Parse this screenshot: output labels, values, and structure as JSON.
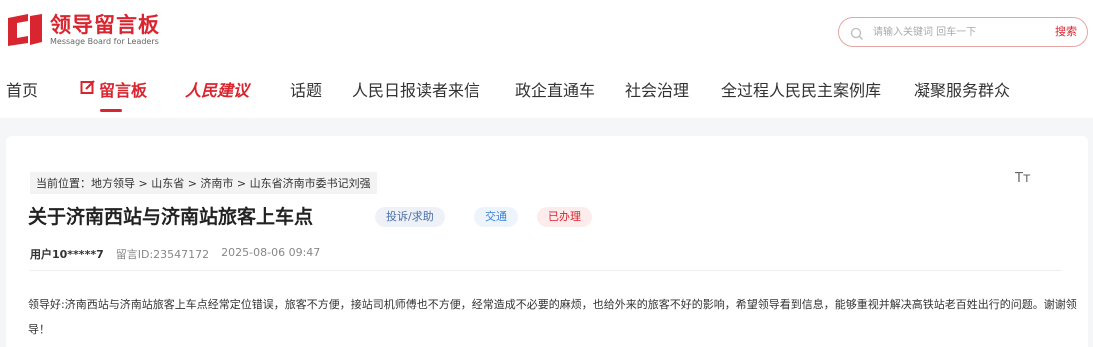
{
  "header": {
    "logo_title": "领导留言板",
    "logo_subtitle": "Message Board for Leaders",
    "brand_color": "#d9252f"
  },
  "search": {
    "placeholder": "请输入关键词 回车一下",
    "button_label": "搜索"
  },
  "nav": {
    "items": [
      {
        "label": "首页"
      },
      {
        "label": "留言板",
        "active": true
      },
      {
        "label": "人民建议"
      },
      {
        "label": "话题"
      },
      {
        "label": "人民日报读者来信"
      },
      {
        "label": "政企直通车"
      },
      {
        "label": "社会治理"
      },
      {
        "label": "全过程人民民主案例库"
      },
      {
        "label": "凝聚服务群众"
      }
    ]
  },
  "breadcrumb": {
    "text": "当前位置：地方领导 > 山东省 > 济南市 > 山东省济南市委书记刘强"
  },
  "font_toggle_icon": "Tт",
  "post": {
    "title": "关于济南西站与济南站旅客上车点",
    "tags": {
      "type": "投诉/求助",
      "domain": "交通",
      "status": "已办理"
    },
    "user": "用户10*****7",
    "message_id": "留言ID:23547172",
    "datetime": "2025-08-06 09:47",
    "content": "领导好:济南西站与济南站旅客上车点经常定位错误，旅客不方便，接站司机师傅也不方便，经常造成不必要的麻烦，也给外来的旅客不好的影响，希望领导看到信息，能够重视并解决高铁站老百姓出行的问题。谢谢领导！"
  }
}
